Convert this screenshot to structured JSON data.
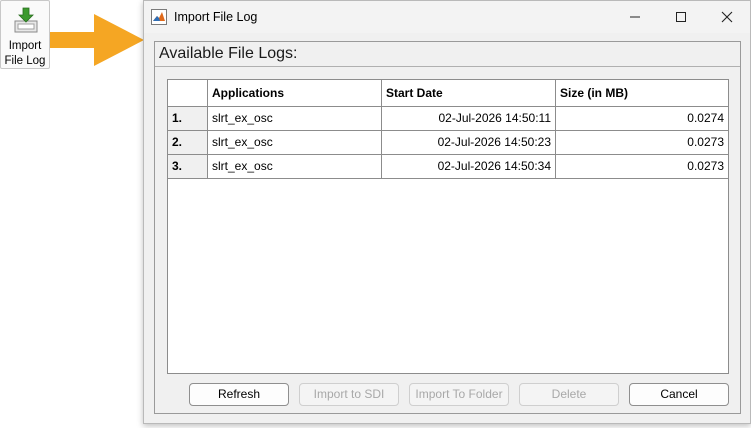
{
  "toolbar": {
    "import_button": {
      "label_line1": "Import",
      "label_line2": "File Log",
      "icon": "import-arrow-icon"
    }
  },
  "window": {
    "title": "Import File Log",
    "controls": [
      "minimize",
      "maximize",
      "close"
    ]
  },
  "panel": {
    "title": "Available File Logs:"
  },
  "table": {
    "columns": [
      "",
      "Applications",
      "Start Date",
      "Size (in MB)"
    ],
    "rows": [
      {
        "index": "1.",
        "application": "slrt_ex_osc",
        "start_date": "02-Jul-2026 14:50:11",
        "size": "0.0274"
      },
      {
        "index": "2.",
        "application": "slrt_ex_osc",
        "start_date": "02-Jul-2026 14:50:23",
        "size": "0.0273"
      },
      {
        "index": "3.",
        "application": "slrt_ex_osc",
        "start_date": "02-Jul-2026 14:50:34",
        "size": "0.0273"
      }
    ]
  },
  "buttons": {
    "refresh": "Refresh",
    "import_sdi": "Import to SDI",
    "import_folder": "Import To Folder",
    "delete": "Delete",
    "cancel": "Cancel"
  },
  "colors": {
    "arrow": "#f5a623",
    "icon_green": "#3c9a2e"
  }
}
